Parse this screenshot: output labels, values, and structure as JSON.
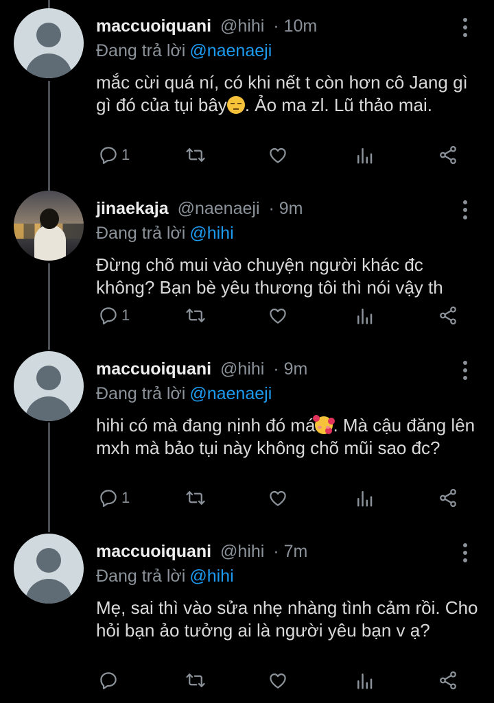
{
  "colors": {
    "background": "#000000",
    "name": "#eeeeee",
    "muted": "#8b9299",
    "mention": "#1d9bf0",
    "body_text": "#d9d9d9",
    "thread_line": "#4a4f55"
  },
  "replying_to_label": "Đang trả lời",
  "tweets": [
    {
      "name": "maccuoiquani",
      "handle": "@hihi",
      "time": "· 10m",
      "mention": "@naenaeji",
      "text_before_emoji": "mắc cừi quá ní, có khi nết t còn hơn cô Jang gì gì đó của tụi bây",
      "emoji": "pensive-face-emoji",
      "text_after_emoji": ". Ảo ma zl. Lũ thảo mai.",
      "reply_count": "1",
      "avatar": "default-avatar-icon"
    },
    {
      "name": "jinaekaja",
      "handle": "@naenaeji",
      "time": "· 9m",
      "mention": "@hihi",
      "text_before_emoji": "Đừng chõ mui vào chuyện người khác đc không? Bạn bè yêu thương tôi thì nói vậy th",
      "emoji": "",
      "text_after_emoji": "",
      "reply_count": "1",
      "avatar": "photo-avatar"
    },
    {
      "name": "maccuoiquani",
      "handle": "@hihi",
      "time": "· 9m",
      "mention": "@naenaeji",
      "text_before_emoji": "hihi có mà đang nịnh đó má",
      "emoji": "smiling-face-with-hearts-emoji",
      "text_after_emoji": ". Mà cậu đăng lên mxh mà bảo tụi này không chõ mũi sao đc?",
      "reply_count": "1",
      "avatar": "default-avatar-icon"
    },
    {
      "name": "maccuoiquani",
      "handle": "@hihi",
      "time": "· 7m",
      "mention": "@hihi",
      "text_before_emoji": "Mẹ, sai thì vào sửa nhẹ nhàng tình cảm rồi. Cho hỏi bạn ảo tưởng ai là người yêu bạn v ạ?",
      "emoji": "",
      "text_after_emoji": "",
      "reply_count": "",
      "avatar": "default-avatar-icon"
    }
  ],
  "action_icons": [
    "reply-icon",
    "retweet-icon",
    "like-icon",
    "analytics-icon",
    "share-icon"
  ]
}
